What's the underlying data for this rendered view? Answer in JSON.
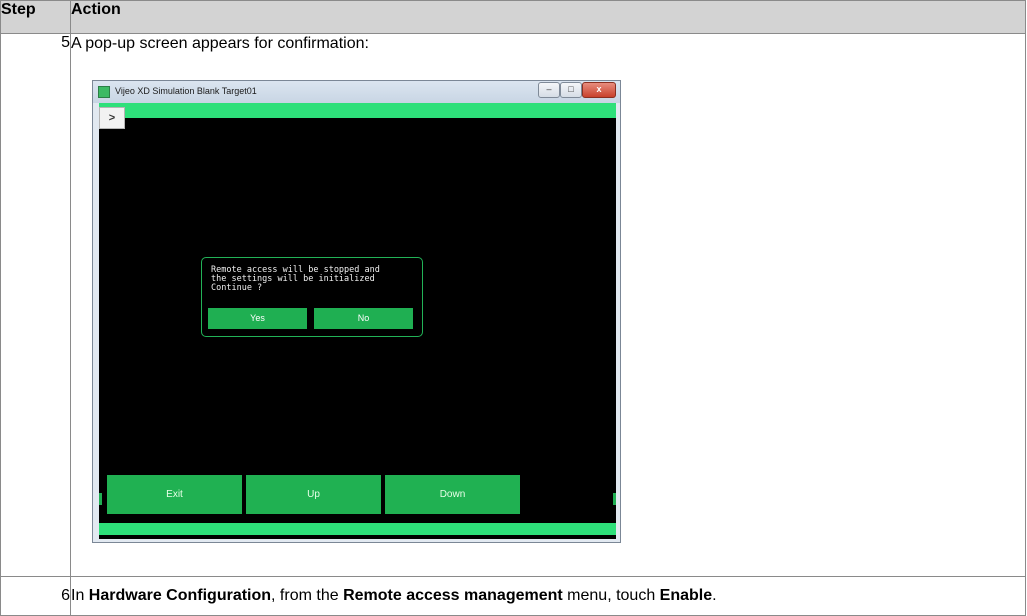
{
  "table": {
    "headers": {
      "step": "Step",
      "action": "Action"
    },
    "rows": [
      {
        "step": "5",
        "action": "A pop-up screen appears for confirmation:"
      },
      {
        "step": "6",
        "segments": [
          {
            "text": "In ",
            "bold": false
          },
          {
            "text": "Hardware Configuration",
            "bold": true
          },
          {
            "text": ", from the ",
            "bold": false
          },
          {
            "text": "Remote access management",
            "bold": true
          },
          {
            "text": " menu, touch ",
            "bold": false
          },
          {
            "text": "Enable",
            "bold": true
          },
          {
            "text": ".",
            "bold": false
          }
        ]
      }
    ]
  },
  "window": {
    "title": "Vijeo XD Simulation Blank Target01",
    "menu_glyph": ">",
    "min_glyph": "–",
    "max_glyph": "□",
    "close_glyph": "x"
  },
  "dialog": {
    "message": "Remote access will be stopped and\nthe settings will be initialized\nContinue ?",
    "yes": "Yes",
    "no": "No"
  },
  "buttons": {
    "exit": "Exit",
    "up": "Up",
    "down": "Down"
  },
  "colors": {
    "screen_bg": "#000000",
    "accent_green": "#2ee07a",
    "button_green": "#20b152",
    "header_gray": "#d3d3d3"
  }
}
